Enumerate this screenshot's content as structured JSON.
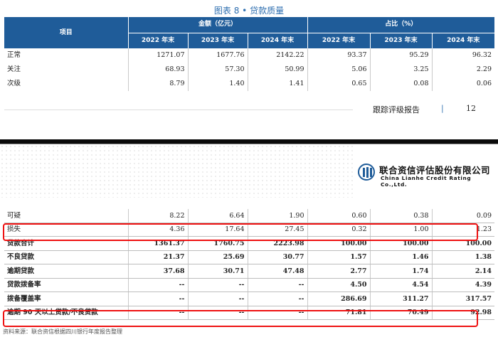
{
  "caption": "图表 8 • 贷款质量",
  "headers": {
    "item": "项目",
    "amount": "金额（亿元）",
    "share": "占比（%）",
    "years": [
      "2022 年末",
      "2023 年末",
      "2024 年末"
    ]
  },
  "top_rows": [
    {
      "label": "正常",
      "a": [
        "1271.07",
        "1677.76",
        "2142.22"
      ],
      "p": [
        "93.37",
        "95.29",
        "96.32"
      ]
    },
    {
      "label": "关注",
      "a": [
        "68.93",
        "57.30",
        "50.99"
      ],
      "p": [
        "5.06",
        "3.25",
        "2.29"
      ]
    },
    {
      "label": "次级",
      "a": [
        "8.79",
        "1.40",
        "1.41"
      ],
      "p": [
        "0.65",
        "0.08",
        "0.06"
      ]
    }
  ],
  "footer": {
    "title": "跟踪评级报告",
    "bar": "|",
    "page": "12"
  },
  "logo": {
    "cn": "联合资信评估股份有限公司",
    "en": "China Lianhe Credit Rating Co.,Ltd."
  },
  "bottom_rows": [
    {
      "label": "可疑",
      "bold": false,
      "a": [
        "8.22",
        "6.64",
        "1.90"
      ],
      "p": [
        "0.60",
        "0.38",
        "0.09"
      ]
    },
    {
      "label": "损失",
      "bold": false,
      "a": [
        "4.36",
        "17.64",
        "27.45"
      ],
      "p": [
        "0.32",
        "1.00",
        "1.23"
      ]
    },
    {
      "label": "贷款合计",
      "bold": true,
      "a": [
        "1361.37",
        "1760.75",
        "2223.98"
      ],
      "p": [
        "100.00",
        "100.00",
        "100.00"
      ]
    },
    {
      "label": "不良贷款",
      "bold": true,
      "a": [
        "21.37",
        "25.69",
        "30.77"
      ],
      "p": [
        "1.57",
        "1.46",
        "1.38"
      ]
    },
    {
      "label": "逾期贷款",
      "bold": true,
      "a": [
        "37.68",
        "30.71",
        "47.48"
      ],
      "p": [
        "2.77",
        "1.74",
        "2.14"
      ]
    },
    {
      "label": "贷款拨备率",
      "bold": true,
      "a": [
        "--",
        "--",
        "--"
      ],
      "p": [
        "4.50",
        "4.54",
        "4.39"
      ]
    },
    {
      "label": "拨备覆盖率",
      "bold": true,
      "a": [
        "--",
        "--",
        "--"
      ],
      "p": [
        "286.69",
        "311.27",
        "317.57"
      ]
    },
    {
      "label": "逾期 90 天以上贷款/不良贷款",
      "bold": true,
      "a": [
        "--",
        "--",
        "--"
      ],
      "p": [
        "71.81",
        "70.49",
        "92.98"
      ]
    }
  ],
  "source": "资料来源：联合资信根据四川银行年度报告整理",
  "colors": {
    "header_bg": "#1f5c99",
    "caption": "#2f6fb0",
    "highlight": "#e11111"
  }
}
